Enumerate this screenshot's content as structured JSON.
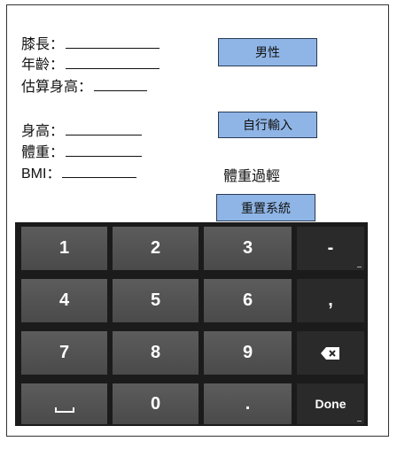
{
  "fields": {
    "knee_length": "膝長",
    "age": "年齡",
    "estimated_height": "估算身高",
    "height": "身高",
    "weight": "體重",
    "bmi": "BMI",
    "colon": "："
  },
  "buttons": {
    "gender": "男性",
    "manual_input": "自行輸入",
    "reset": "重置系統"
  },
  "status": "體重過輕",
  "keypad": {
    "row1": [
      "1",
      "2",
      "3",
      "-"
    ],
    "row2": [
      "4",
      "5",
      "6",
      ","
    ],
    "row3": [
      "7",
      "8",
      "9"
    ],
    "row4": [
      "0",
      "."
    ],
    "done": "Done",
    "icons": {
      "backspace": "backspace-icon",
      "space": "space-icon"
    }
  }
}
